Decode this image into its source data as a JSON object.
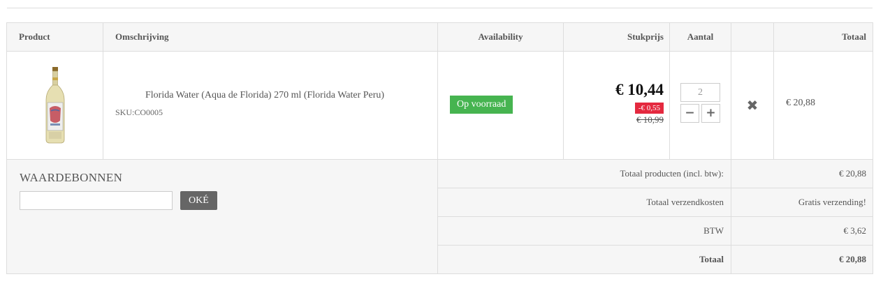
{
  "headers": {
    "product": "Product",
    "description": "Omschrijving",
    "availability": "Availability",
    "unit_price": "Stukprijs",
    "quantity": "Aantal",
    "total": "Totaal"
  },
  "item": {
    "name": "Florida Water (Aqua de Florida) 270 ml (Florida Water Peru)",
    "sku": "SKU:CO0005",
    "stock": "Op voorraad",
    "price": "€ 10,44",
    "discount": "-€ 0,55",
    "old_price": "€ 10,99",
    "quantity": "2",
    "line_total": "€ 20,88",
    "image_icon": "bottle-icon"
  },
  "icons": {
    "minus": "−",
    "plus": "+",
    "remove": "✖"
  },
  "voucher": {
    "title": "WAARDEBONNEN",
    "input_value": "",
    "button": "OKÉ"
  },
  "summary": {
    "products_label": "Totaal producten (incl. btw):",
    "products_value": "€ 20,88",
    "shipping_label": "Totaal verzendkosten",
    "shipping_value": "Gratis verzending!",
    "tax_label": "BTW",
    "tax_value": "€ 3,62",
    "total_label": "Totaal",
    "total_value": "€ 20,88"
  },
  "colors": {
    "stock_badge": "#46b450",
    "discount_badge": "#e4293f",
    "ok_button": "#666666"
  }
}
